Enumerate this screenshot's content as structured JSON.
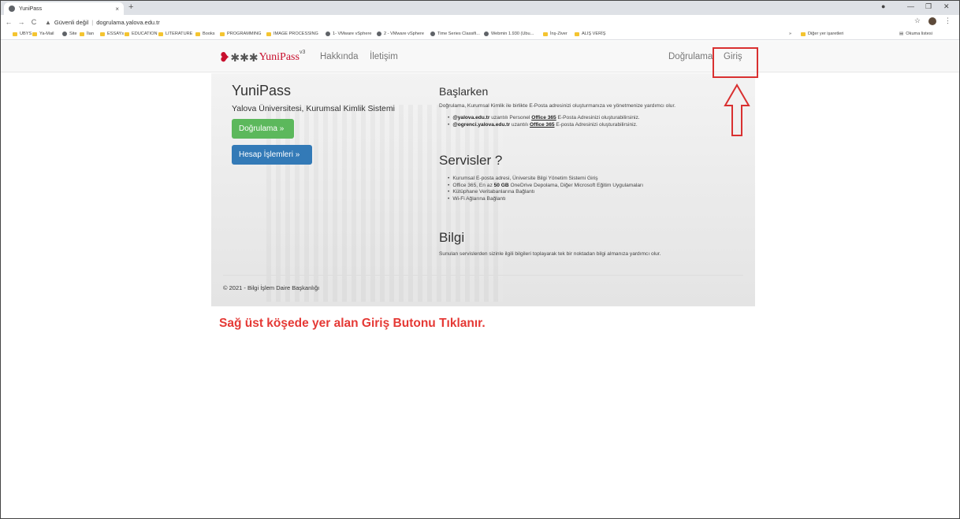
{
  "tab": {
    "title": "YuniPass",
    "close": "×",
    "new_tab": "+"
  },
  "window_controls": {
    "minimize": "—",
    "maximize": "❐",
    "close": "✕"
  },
  "address": {
    "warning": "Güvenli değil",
    "url": "dogrulama.yalova.edu.tr"
  },
  "bookmarks": {
    "items": [
      "UBYS",
      "Ya-Mail",
      "Site",
      "İlan",
      "ESSAYs",
      "EDUCATION",
      "LITERATURE",
      "Books",
      "PROGRAMMING",
      "IMAGE PROCESSING",
      "1- VMware vSphere",
      "2 - VMware vSphere",
      "Time Series Classifi...",
      "Webmin 1.930 (Ubu...",
      "İnş-Ziver",
      "ALIŞ VERİŞ"
    ],
    "more": "»",
    "other": "Diğer yer işaretleri",
    "reading_list": "Okuma listesi"
  },
  "navbar": {
    "brand_text": "YuniPass",
    "brand_version": "v3",
    "links": [
      "Hakkında",
      "İletişim"
    ],
    "right_links": [
      "Doğrulama",
      "Giriş"
    ]
  },
  "hero": {
    "title": "YuniPass",
    "subtitle": "Yalova Üniversitesi, Kurumsal Kimlik Sistemi",
    "btn_verify": "Doğrulama »",
    "btn_account": "Hesap İşlemleri »"
  },
  "sections": {
    "start_title": "Başlarken",
    "start_text": "Doğrulama, Kurumsal Kimlik ile birlikte E-Posta adresinizi oluşturmanıza ve yönetmenize yardımcı olur.",
    "start_items": [
      {
        "bold": "@yalova.edu.tr",
        "pre": " uzantılı Personel ",
        "link": "Office 365",
        "post": " E-Posta Adresinizi oluşturabilirsiniz."
      },
      {
        "bold": "@ogrenci.yalova.edu.tr",
        "pre": " uzantılı ",
        "link": "Office 365",
        "post": " E-posta Adresinizi oluşturabilirsiniz."
      }
    ],
    "services_title": "Servisler ?",
    "services_items": [
      "Kurumsal E-posta adresi, Üniversite Bilgi Yönetim Sistemi Giriş",
      "Office 365, En az 50 GB OneDrive Depolama, Diğer Microsoft Eğitim Uygulamaları",
      "Kütüphane Veritabanlarına Bağlantı",
      "Wi-Fi Ağlarına Bağlantı"
    ],
    "info_title": "Bilgi",
    "info_text": "Sunulan servislerden sizinle ilgili bilgileri toplayarak tek bir noktadan bilgi almanıza yardımcı olur."
  },
  "footer": {
    "text": "© 2021 - Bilgi İşlem Daire Başkanlığı"
  },
  "instruction": {
    "text": "Sağ üst köşede yer alan Giriş Butonu Tıklanır."
  },
  "colors": {
    "accent_red": "#d93030",
    "btn_green": "#5cb85c",
    "btn_blue": "#337ab7",
    "brand_red": "#c8102e"
  }
}
